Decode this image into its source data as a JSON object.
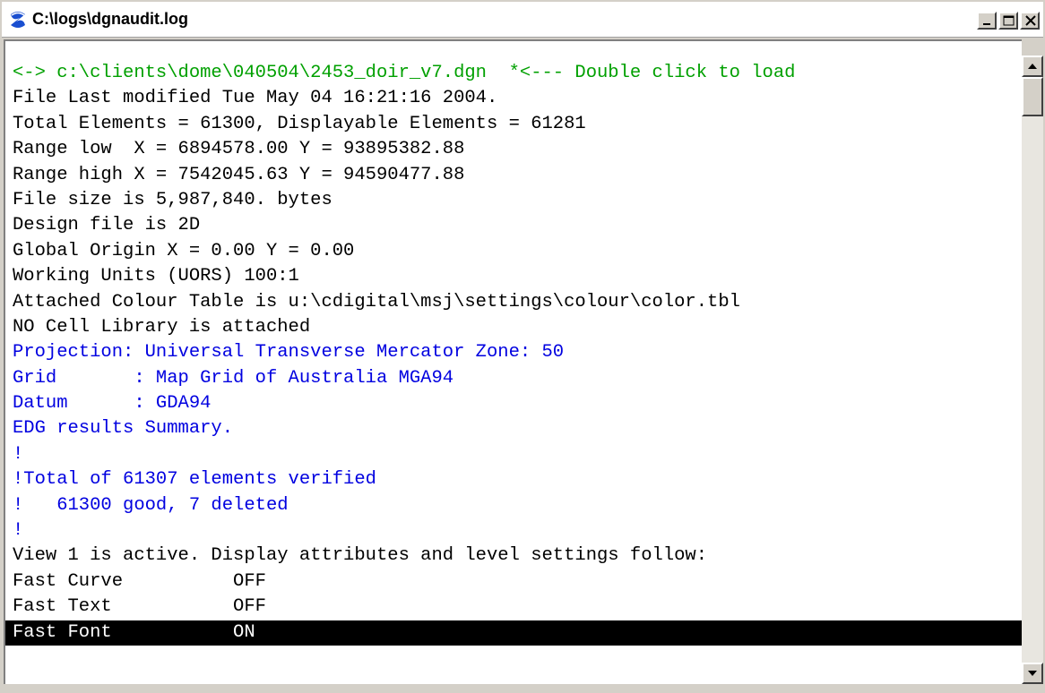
{
  "window": {
    "title": "C:\\logs\\dgnaudit.log",
    "icon": "app-logo-icon"
  },
  "title_buttons": {
    "minimize": "minimize-icon",
    "maximize": "maximize-icon",
    "close": "close-icon"
  },
  "colors": {
    "green_text": "#00a000",
    "blue_text": "#0000e0",
    "selection_bg": "#000000"
  },
  "log_lines": [
    {
      "text": "<-> c:\\clients\\dome\\040504\\2453_doir_v7.dgn  *<--- Double click to load",
      "style": "green"
    },
    {
      "text": "File Last modified Tue May 04 16:21:16 2004.",
      "style": "normal"
    },
    {
      "text": "Total Elements = 61300, Displayable Elements = 61281",
      "style": "normal"
    },
    {
      "text": "Range low  X = 6894578.00 Y = 93895382.88",
      "style": "normal"
    },
    {
      "text": "Range high X = 7542045.63 Y = 94590477.88",
      "style": "normal"
    },
    {
      "text": "File size is 5,987,840. bytes",
      "style": "normal"
    },
    {
      "text": "Design file is 2D",
      "style": "normal"
    },
    {
      "text": "Global Origin X = 0.00 Y = 0.00",
      "style": "normal"
    },
    {
      "text": "Working Units (UORS) 100:1",
      "style": "normal"
    },
    {
      "text": "Attached Colour Table is u:\\cdigital\\msj\\settings\\colour\\color.tbl",
      "style": "normal"
    },
    {
      "text": "NO Cell Library is attached",
      "style": "normal"
    },
    {
      "text": "Projection: Universal Transverse Mercator Zone: 50",
      "style": "blue"
    },
    {
      "text": "Grid       : Map Grid of Australia MGA94",
      "style": "blue"
    },
    {
      "text": "Datum      : GDA94",
      "style": "blue"
    },
    {
      "text": "EDG results Summary.",
      "style": "blue"
    },
    {
      "text": "!",
      "style": "blue"
    },
    {
      "text": "!Total of 61307 elements verified",
      "style": "blue"
    },
    {
      "text": "!   61300 good, 7 deleted",
      "style": "blue"
    },
    {
      "text": "!",
      "style": "blue"
    },
    {
      "text": "View 1 is active. Display attributes and level settings follow:",
      "style": "normal"
    },
    {
      "text": "Fast Curve          OFF",
      "style": "normal"
    },
    {
      "text": "Fast Text           OFF",
      "style": "normal"
    },
    {
      "text": "Fast Font           ON",
      "style": "selected"
    }
  ],
  "scrollbar": {
    "up": "scroll-up-arrow-icon",
    "down": "scroll-down-arrow-icon"
  }
}
